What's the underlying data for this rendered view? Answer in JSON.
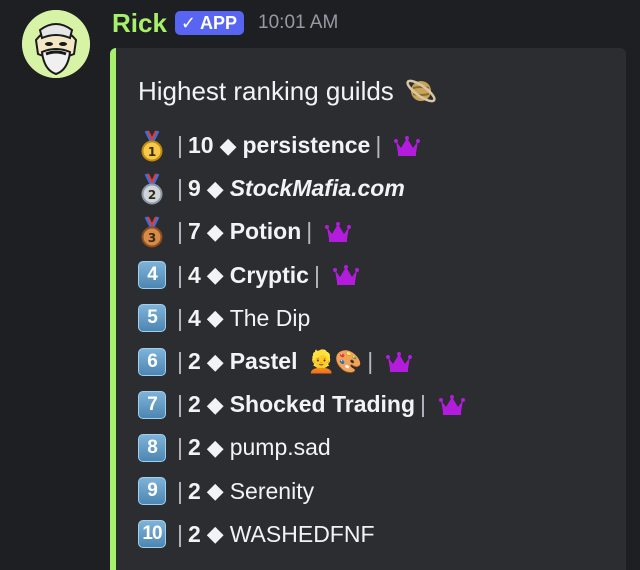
{
  "message": {
    "username": "Rick",
    "badge": "APP",
    "badge_check": "✓",
    "timestamp": "10:01 AM",
    "colors": {
      "username": "#a7f06b",
      "badge": "#5865f2",
      "embed_accent": "#a7f06b",
      "crown": "#b31cdc"
    }
  },
  "embed": {
    "title": "Highest ranking guilds",
    "title_emoji": "🪐",
    "separator": "|",
    "diamond": "◆",
    "rows": [
      {
        "rank_icon": "gold-medal",
        "level": "10",
        "name": "persistence",
        "style": "bold",
        "crown": true,
        "extra_emoji": ""
      },
      {
        "rank_icon": "silver-medal",
        "level": "9",
        "name": "StockMafia.com",
        "style": "italic",
        "crown": false,
        "extra_emoji": ""
      },
      {
        "rank_icon": "bronze-medal",
        "level": "7",
        "name": "Potion",
        "style": "bold",
        "crown": true,
        "extra_emoji": ""
      },
      {
        "rank_icon": "keycap",
        "keycap": "4",
        "level": "4",
        "name": "Cryptic",
        "style": "bold",
        "crown": true,
        "extra_emoji": ""
      },
      {
        "rank_icon": "keycap",
        "keycap": "5",
        "level": "4",
        "name": "The Dip",
        "style": "normal",
        "crown": false,
        "extra_emoji": ""
      },
      {
        "rank_icon": "keycap",
        "keycap": "6",
        "level": "2",
        "name": "Pastel",
        "style": "bold",
        "crown": true,
        "extra_emoji": "👱🎨"
      },
      {
        "rank_icon": "keycap",
        "keycap": "7",
        "level": "2",
        "name": "Shocked Trading",
        "style": "bold",
        "crown": true,
        "extra_emoji": ""
      },
      {
        "rank_icon": "keycap",
        "keycap": "8",
        "level": "2",
        "name": "pump.sad",
        "style": "normal",
        "crown": false,
        "extra_emoji": ""
      },
      {
        "rank_icon": "keycap",
        "keycap": "9",
        "level": "2",
        "name": "Serenity",
        "style": "normal",
        "crown": false,
        "extra_emoji": ""
      },
      {
        "rank_icon": "keycap",
        "keycap": "10",
        "level": "2",
        "name": "WASHEDFNF",
        "style": "normal",
        "crown": false,
        "extra_emoji": ""
      }
    ]
  }
}
